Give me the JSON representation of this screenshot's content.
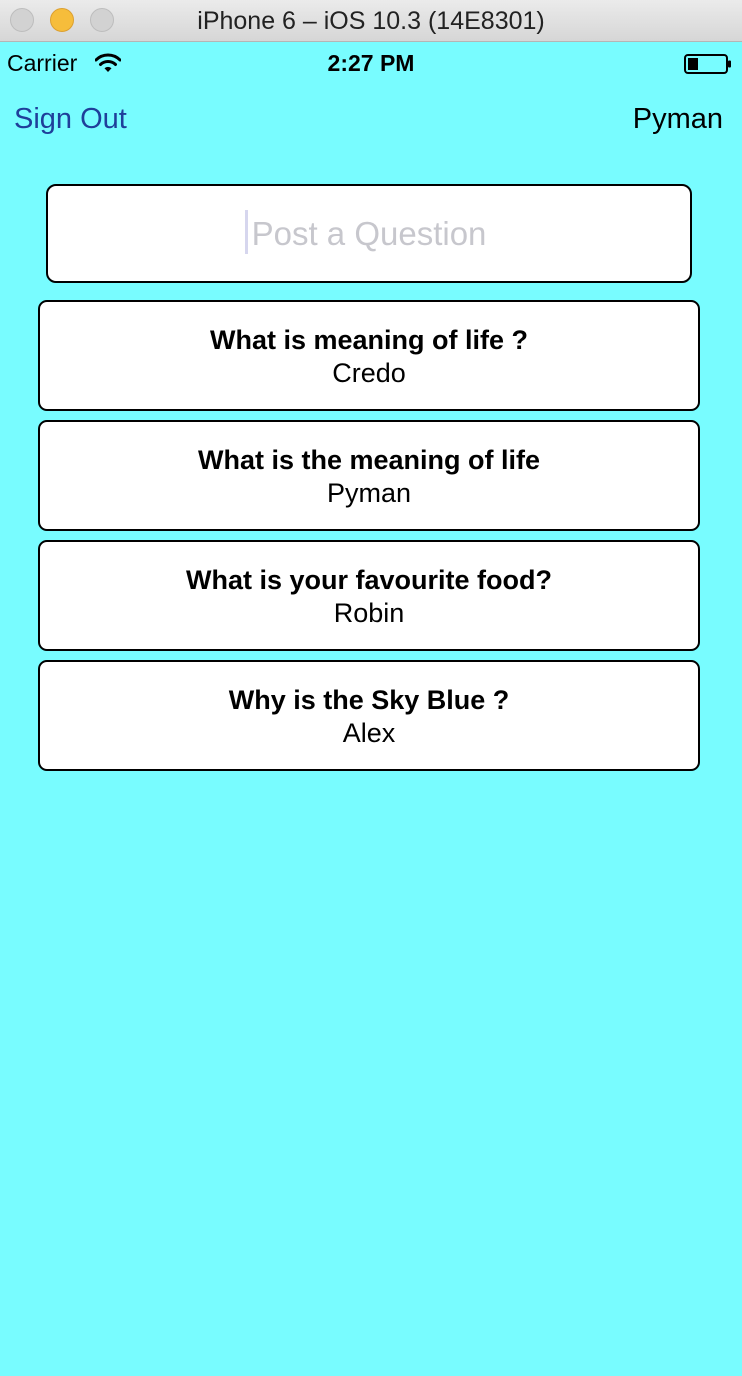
{
  "window": {
    "title": "iPhone 6 – iOS 10.3 (14E8301)"
  },
  "status_bar": {
    "carrier": "Carrier",
    "time": "2:27 PM",
    "icons": [
      "wifi-icon",
      "battery-icon"
    ]
  },
  "nav": {
    "sign_out_label": "Sign Out",
    "username": "Pyman"
  },
  "post": {
    "placeholder": "Post a Question",
    "value": ""
  },
  "questions": [
    {
      "title": "What is meaning of life ?",
      "author": "Credo"
    },
    {
      "title": "What is the meaning of life",
      "author": "Pyman"
    },
    {
      "title": "What is your favourite food?",
      "author": "Robin"
    },
    {
      "title": "Why is the Sky Blue ?",
      "author": "Alex"
    }
  ],
  "colors": {
    "background": "#78fcff",
    "link": "#1f3f9a",
    "card": "#ffffff",
    "border": "#000000"
  }
}
